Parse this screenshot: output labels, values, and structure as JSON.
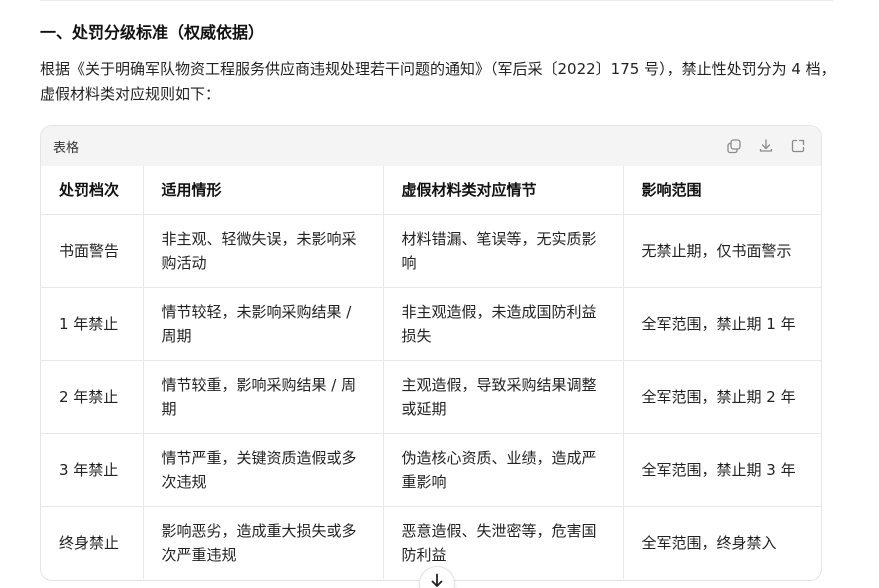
{
  "section": {
    "heading": "一、处罚分级标准（权威依据）",
    "intro": "根据《关于明确军队物资工程服务供应商违规处理若干问题的通知》（军后采〔2022〕175 号），禁止性处罚分为 4 档，虚假材料类对应规则如下："
  },
  "table_card": {
    "title": "表格",
    "actions": [
      {
        "icon": "copy-icon"
      },
      {
        "icon": "download-icon"
      },
      {
        "icon": "expand-icon"
      }
    ],
    "headers": [
      "处罚档次",
      "适用情形",
      "虚假材料类对应情节",
      "影响范围"
    ],
    "rows": [
      [
        "书面警告",
        "非主观、轻微失误，未影响采购活动",
        "材料错漏、笔误等，无实质影响",
        "无禁止期，仅书面警示"
      ],
      [
        "1 年禁止",
        "情节较轻，未影响采购结果 / 周期",
        "非主观造假，未造成国防利益损失",
        "全军范围，禁止期 1 年"
      ],
      [
        "2 年禁止",
        "情节较重，影响采购结果 / 周期",
        "主观造假，导致采购结果调整或延期",
        "全军范围，禁止期 2 年"
      ],
      [
        "3 年禁止",
        "情节严重，关键资质造假或多次违规",
        "伪造核心资质、业绩，造成严重影响",
        "全军范围，禁止期 3 年"
      ],
      [
        "终身禁止",
        "影响恶劣，造成重大损失或多次严重违规",
        "恶意造假、失泄密等，危害国防利益",
        "全军范围，终身禁入"
      ]
    ]
  },
  "scroll_button": {
    "icon": "arrow-down-icon"
  }
}
